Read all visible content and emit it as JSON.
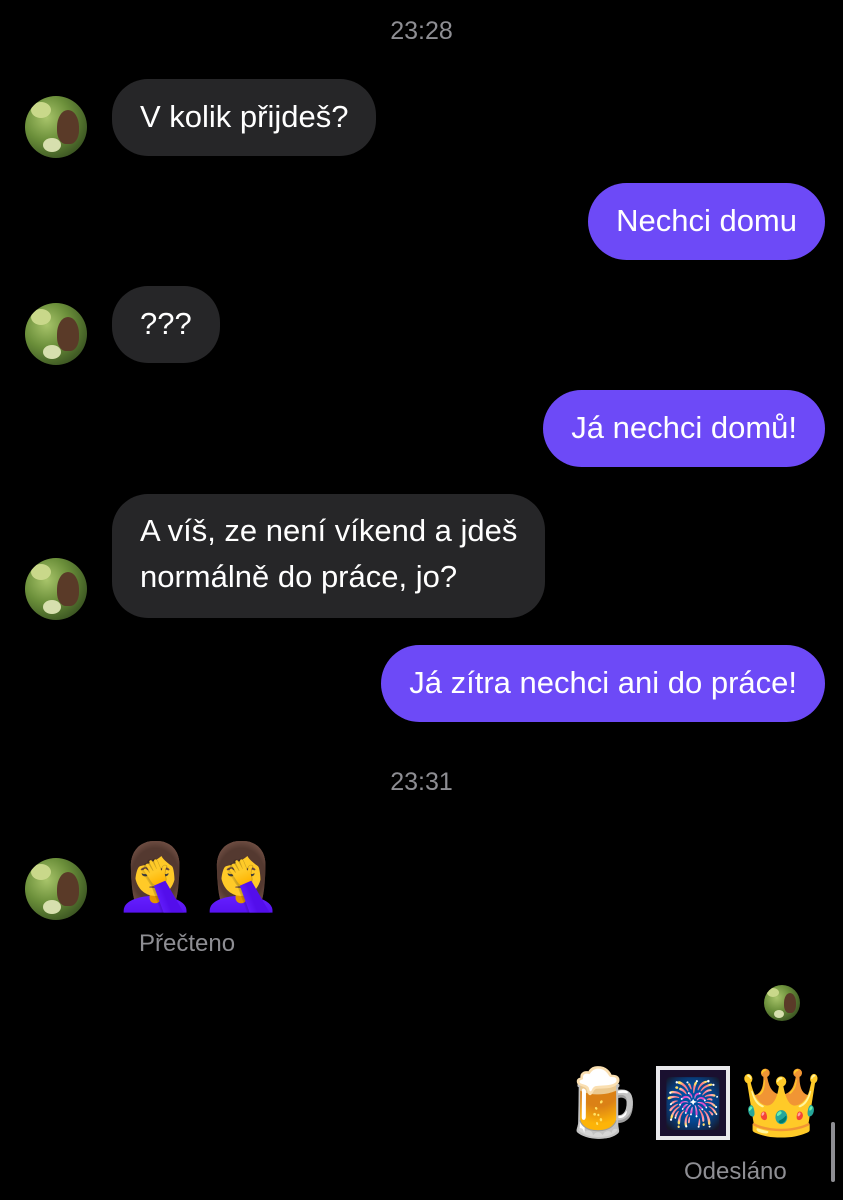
{
  "timestamps": [
    "23:28",
    "23:31"
  ],
  "messages": [
    {
      "direction": "incoming",
      "text": "V kolik přijdeš?"
    },
    {
      "direction": "outgoing",
      "text": "Nechci domu"
    },
    {
      "direction": "incoming",
      "text": "???"
    },
    {
      "direction": "outgoing",
      "text": "Já nechci domů!"
    },
    {
      "direction": "incoming",
      "lines": [
        "A víš, ze není víkend a jdeš",
        "normálně do práce, jo?"
      ]
    },
    {
      "direction": "outgoing",
      "text": "Já zítra nechci ani do práce!"
    },
    {
      "direction": "incoming",
      "emojis": [
        "🤦‍♀️",
        "🤦‍♀️"
      ]
    },
    {
      "direction": "outgoing",
      "emojis": [
        "🍺",
        "🎆",
        "👑"
      ]
    }
  ],
  "status": {
    "read": "Přečteno",
    "sent": "Odesláno"
  },
  "colors": {
    "background": "#000000",
    "incoming_bubble": "#262628",
    "outgoing_bubble": "#6d4af7",
    "meta_text": "#8e8e93"
  },
  "icons": {
    "contact_avatar": "contact-avatar-photo",
    "read_receipt_avatar": "read-receipt-avatar-photo"
  }
}
